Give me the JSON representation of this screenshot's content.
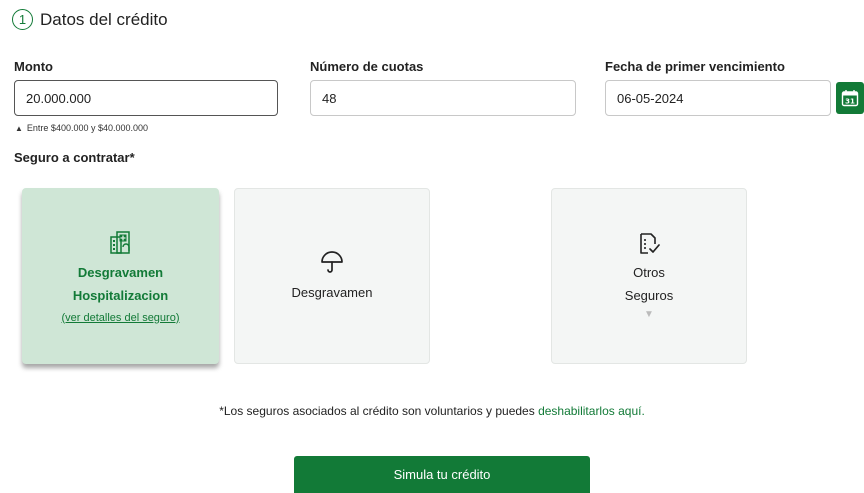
{
  "header": {
    "step": "1",
    "title": "Datos del crédito"
  },
  "fields": {
    "monto": {
      "label": "Monto",
      "value": "20.000.000",
      "hint": "Entre $400.000 y $40.000.000"
    },
    "cuotas": {
      "label": "Número de cuotas",
      "value": "48"
    },
    "fecha": {
      "label": "Fecha de primer vencimiento",
      "value": "06-05-2024",
      "calendar_day": "31"
    }
  },
  "seguro": {
    "label": "Seguro a contratar*",
    "cards": [
      {
        "title_line1": "Desgravamen",
        "title_line2": "Hospitalizacion",
        "link": "(ver detalles del seguro)",
        "icon": "hospital-icon",
        "selected": true
      },
      {
        "title": "Desgravamen",
        "icon": "umbrella-icon",
        "selected": false
      },
      {
        "title_line1": "Otros",
        "title_line2": "Seguros",
        "icon": "document-check-icon",
        "selected": false
      }
    ]
  },
  "disclaimer": {
    "text": "*Los seguros asociados al crédito son voluntarios y puedes ",
    "link": "deshabilitarlos aquí."
  },
  "submit_label": "Simula tu crédito",
  "colors": {
    "accent": "#127a37",
    "selected_card": "#cfe6d6",
    "card_bg": "#f4f6f5"
  }
}
